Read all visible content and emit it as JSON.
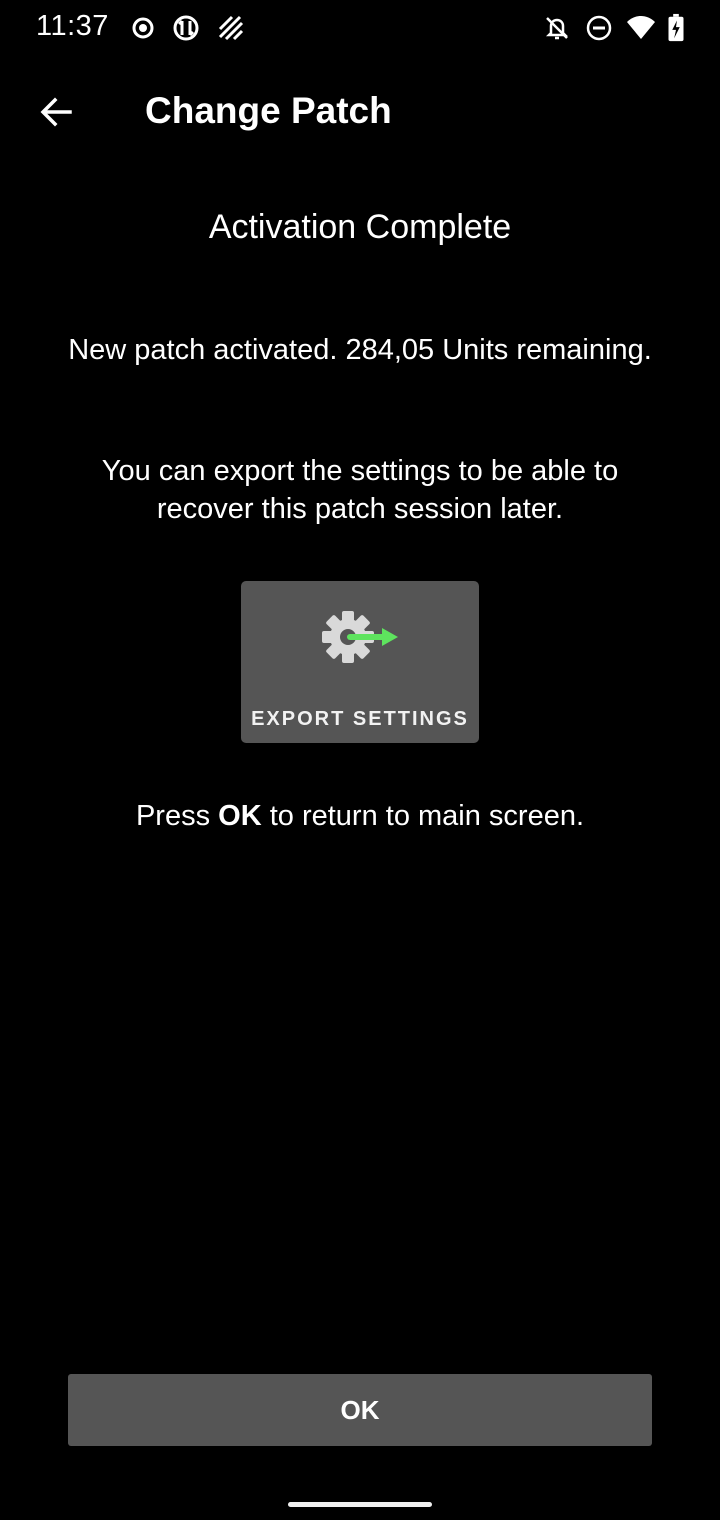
{
  "status_bar": {
    "time": "11:37",
    "left_icons": [
      "record-icon",
      "sync-icon",
      "signal-hatch-icon"
    ],
    "right_icons": [
      "notifications-off-icon",
      "do-not-disturb-icon",
      "wifi-icon",
      "battery-charging-icon"
    ]
  },
  "app_bar": {
    "back_icon": "arrow-back-icon",
    "title": "Change Patch"
  },
  "content": {
    "heading": "Activation Complete",
    "message_1": "New patch activated. 284,05 Units remaining.",
    "message_2": "You can export the settings to be able to recover this patch session later.",
    "export_button": {
      "label": "EXPORT SETTINGS",
      "icon": "gear-export-icon"
    },
    "press_prefix": "Press ",
    "press_ok": "OK",
    "press_suffix": " to return to main screen."
  },
  "footer": {
    "ok_label": "OK"
  },
  "colors": {
    "background": "#000000",
    "button_bg": "#555555",
    "gear": "#d9d9d9",
    "arrow": "#5ee35e"
  }
}
